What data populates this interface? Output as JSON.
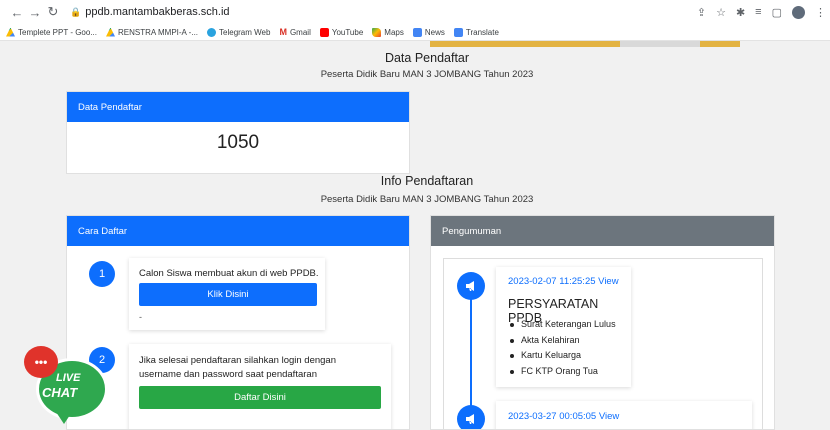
{
  "browser": {
    "url": "ppdb.mantambakberas.sch.id",
    "bookmarks": [
      {
        "label": "Templete PPT - Goo...",
        "icon": "drive-icon"
      },
      {
        "label": "RENSTRA MMPI-A -...",
        "icon": "drive-icon"
      },
      {
        "label": "Telegram Web",
        "icon": "telegram-icon"
      },
      {
        "label": "Gmail",
        "icon": "gmail-icon"
      },
      {
        "label": "YouTube",
        "icon": "youtube-icon"
      },
      {
        "label": "Maps",
        "icon": "maps-icon"
      },
      {
        "label": "News",
        "icon": "news-icon"
      },
      {
        "label": "Translate",
        "icon": "translate-icon"
      }
    ]
  },
  "data_pendaftar": {
    "title": "Data Pendaftar",
    "subtitle": "Peserta Didik Baru MAN 3 JOMBANG Tahun 2023",
    "card_header": "Data Pendaftar",
    "count": "1050"
  },
  "info": {
    "title": "Info Pendaftaran",
    "subtitle": "Peserta Didik Baru MAN 3 JOMBANG Tahun 2023"
  },
  "cara_daftar": {
    "header": "Cara Daftar",
    "steps": [
      {
        "num": "1",
        "text": "Calon Siswa membuat akun di web PPDB.",
        "button": "Klik Disini",
        "note": "-"
      },
      {
        "num": "2",
        "text": "Jika selesai pendaftaran silahkan login dengan username dan password saat pendaftaran",
        "button": "Daftar Disini"
      }
    ]
  },
  "pengumuman": {
    "header": "Pengumuman",
    "items": [
      {
        "date": "2023-02-07 11:25:25 View",
        "title": "PERSYARATAN PPDB",
        "list": [
          "Surat Keterangan Lulus",
          "Akta Kelahiran",
          "Kartu Keluarga",
          "FC KTP Orang Tua"
        ]
      },
      {
        "date": "2023-03-27 00:05:05 View"
      }
    ]
  },
  "live_chat": {
    "line1": "LIVE",
    "line2": "CHAT",
    "dots": "•••"
  },
  "colors": {
    "primary": "#0d6efd",
    "secondary": "#6c757d",
    "success": "#28a745",
    "chat_red": "#e0332b",
    "chat_green": "#2fa84f"
  }
}
